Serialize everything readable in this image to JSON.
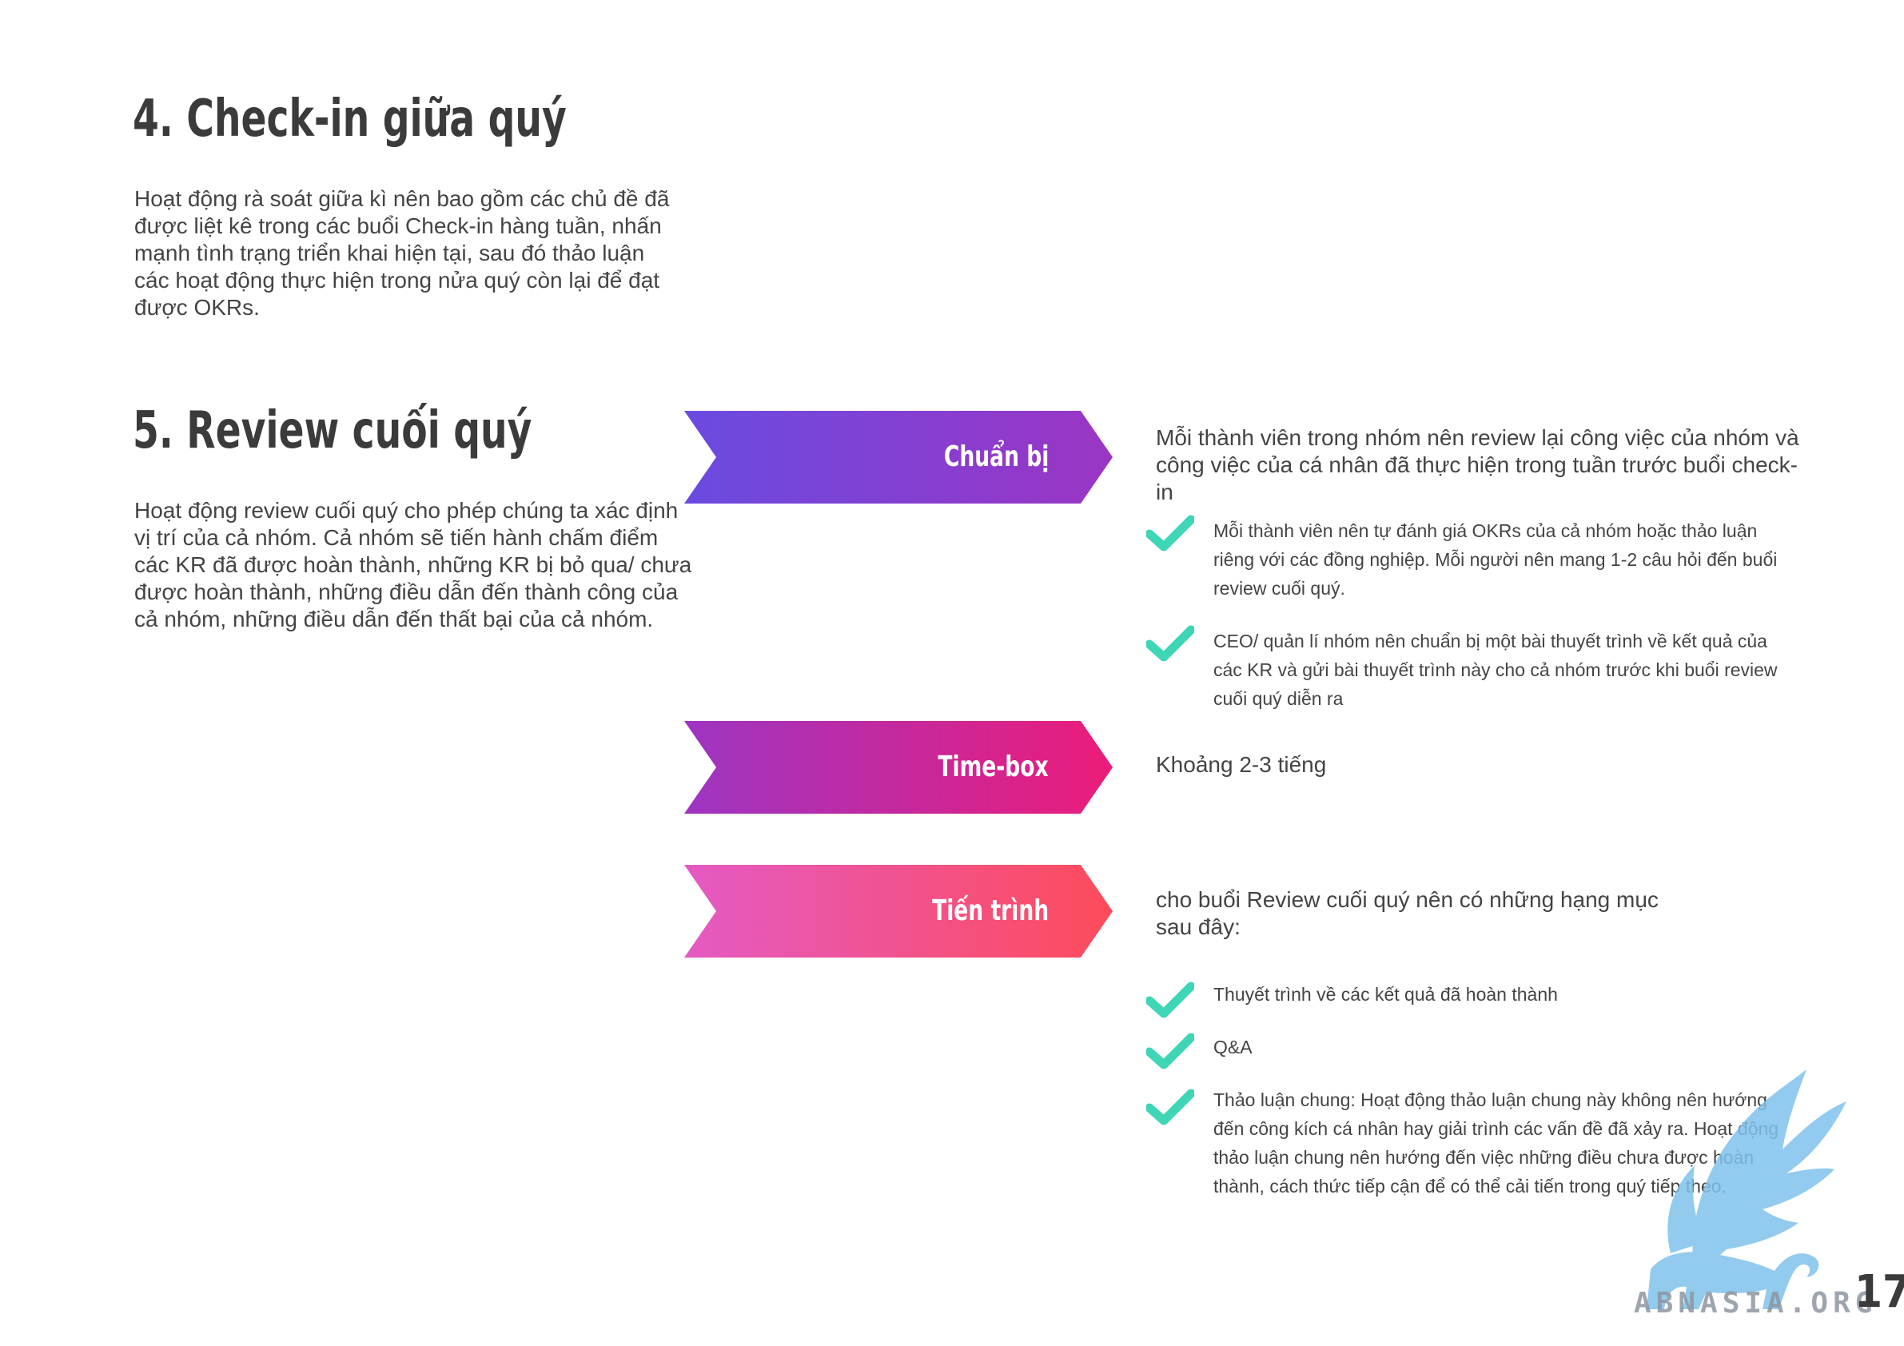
{
  "section4": {
    "title": "4. Check-in giữa quý",
    "body": [
      "Hoạt động rà soát giữa kì nên bao gồm các chủ đề đã",
      "được liệt kê trong các buổi Check-in hàng tuần, nhấn",
      "mạnh tình trạng triển khai hiện tại, sau đó thảo luận",
      "các hoạt động thực hiện trong nửa quý còn lại để đạt",
      "được OKRs."
    ]
  },
  "section5": {
    "title": "5. Review cuối quý",
    "body": [
      "Hoạt động review cuối quý cho phép chúng ta xác định",
      "vị trí của cả nhóm. Cả nhóm sẽ tiến hành chấm điểm",
      "các KR đã được hoàn thành, những KR bị bỏ qua/ chưa",
      "được hoàn thành, những điều dẫn đến thành công của",
      "cả nhóm, những điều dẫn đến thất bại của cả nhóm."
    ]
  },
  "steps": {
    "prepare": {
      "label": "Chuẩn bị",
      "desc": [
        "Mỗi thành viên trong nhóm nên review lại công việc của nhóm và",
        "công việc của cá nhân đã thực hiện trong tuần trước buổi check-in"
      ],
      "items": [
        [
          "Mỗi thành viên nên tự đánh giá OKRs của cả nhóm hoặc thảo luận",
          "riêng với các đồng nghiệp. Mỗi người nên mang 1-2 câu hỏi đến buổi",
          "review cuối quý."
        ],
        [
          "CEO/ quản lí nhóm nên chuẩn bị một bài thuyết trình về kết quả của",
          "các KR và gửi bài thuyết trình này cho cả nhóm trước khi buổi review",
          "cuối quý diễn ra"
        ]
      ]
    },
    "timebox": {
      "label": "Time-box",
      "desc": "Khoảng 2-3 tiếng"
    },
    "process": {
      "label": "Tiến trình",
      "desc": [
        "cho buổi Review cuối quý nên có những hạng mục",
        "sau đây:"
      ],
      "items": [
        [
          "Thuyết trình về các kết quả đã hoàn thành"
        ],
        [
          "Q&A"
        ],
        [
          "Thảo luận chung: Hoạt động thảo luận chung này không nên hướng",
          "đến công kích cá nhân hay giải trình các vấn đề đã xảy ra. Hoạt động",
          "thảo luận chung nên hướng đến việc những điều chưa được hoàn",
          "thành, cách thức tiếp cận để có thể cải tiến trong quý tiếp theo."
        ]
      ]
    }
  },
  "colors": {
    "prepare": [
      "#6a4be0",
      "#9b35c4"
    ],
    "timebox": [
      "#9d35c2",
      "#ec1c79"
    ],
    "process": [
      "#e45ac4",
      "#fe4b5a"
    ],
    "check": "#3fd6b8",
    "watermark": "#7fc2ec"
  },
  "watermark": {
    "text": "ABNASIA.ORG",
    "icon": "feather-lion-icon"
  },
  "page_number": "17"
}
